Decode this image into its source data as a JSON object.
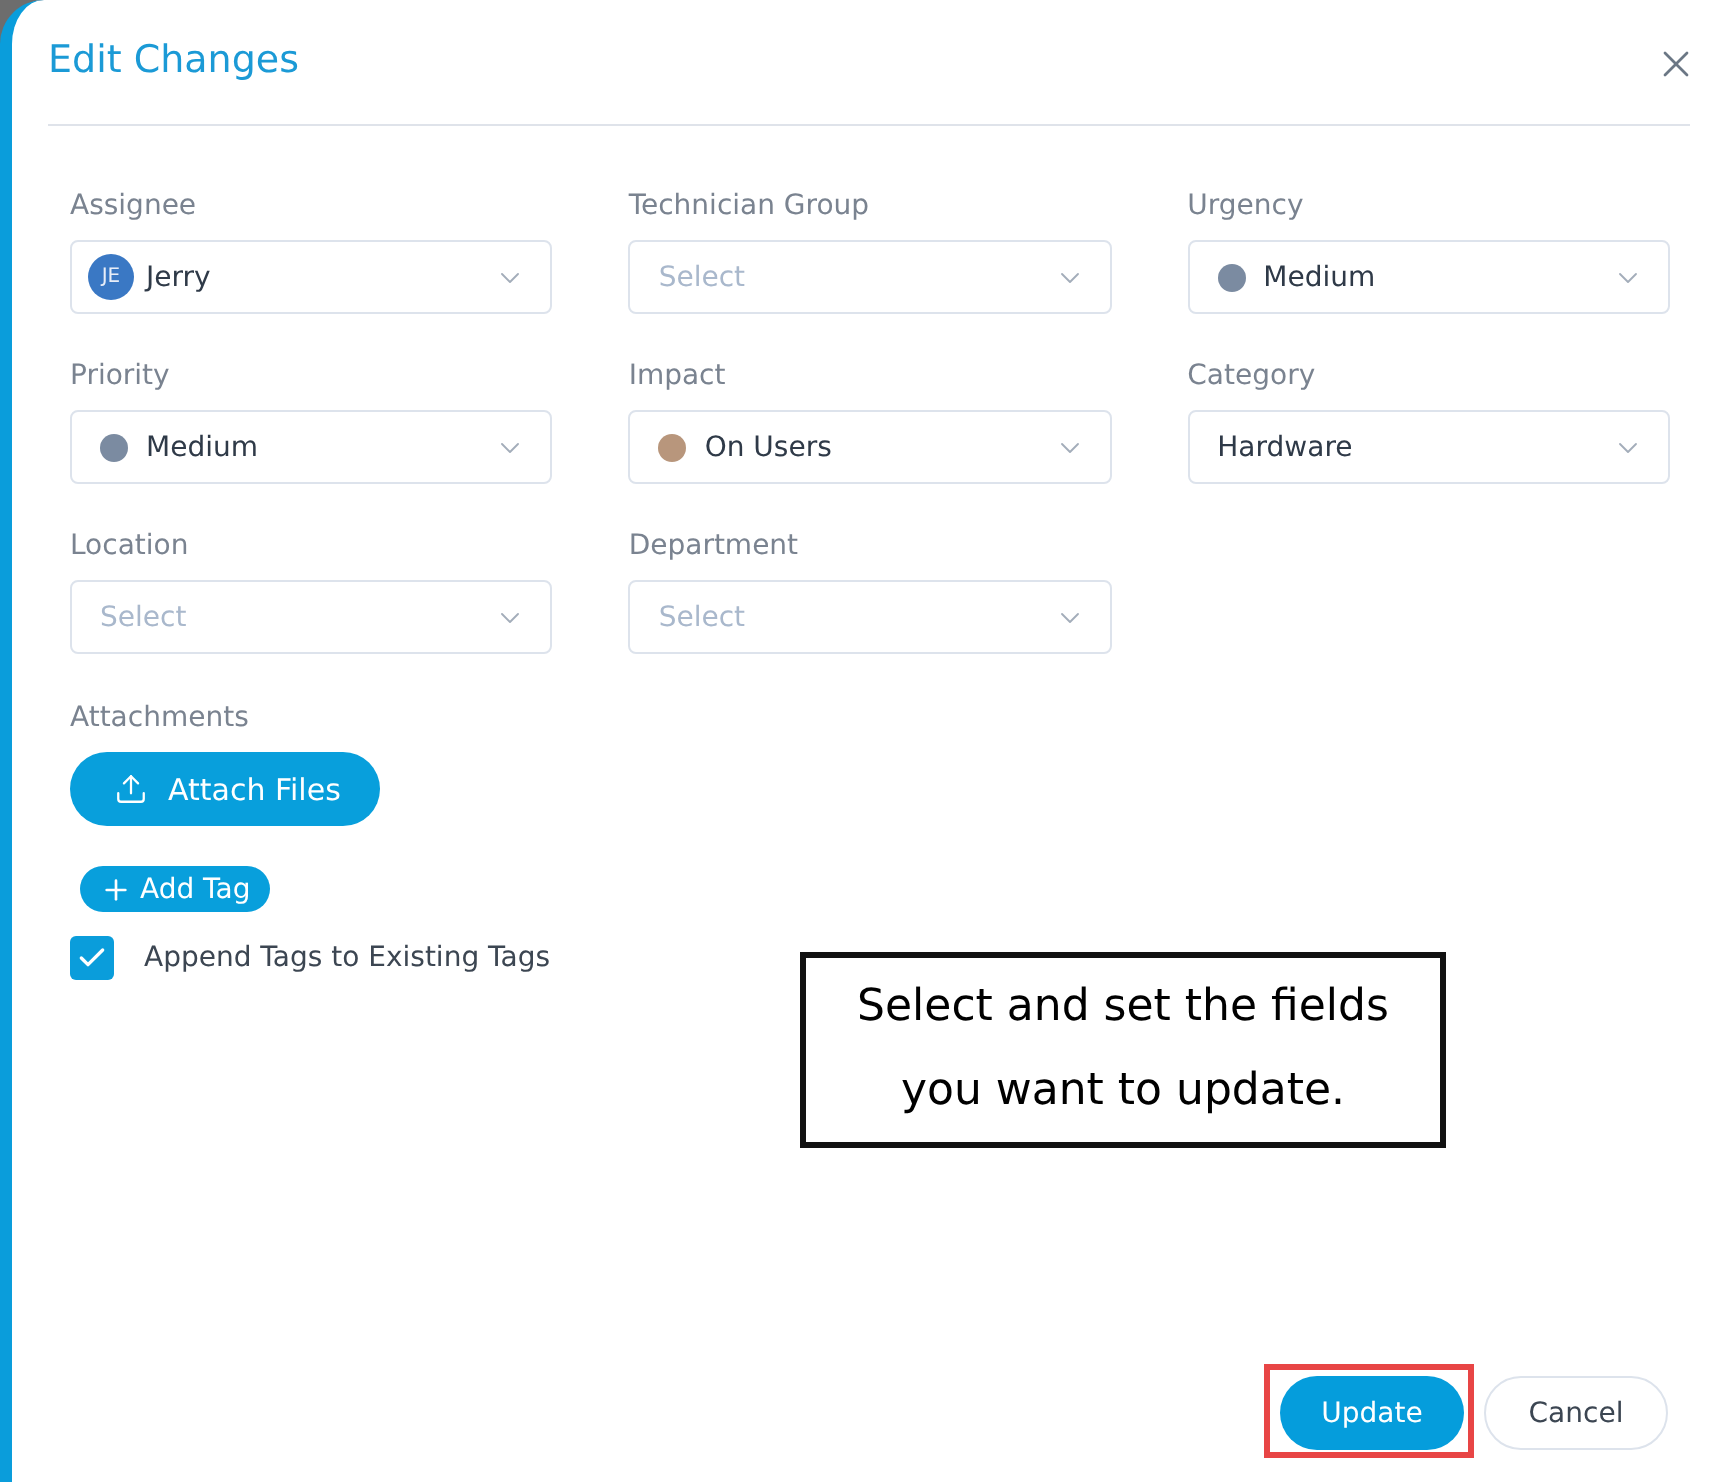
{
  "dialog": {
    "title": "Edit Changes"
  },
  "fields": [
    {
      "label": "Assignee",
      "kind": "avatar",
      "initials": "JE",
      "value": "Jerry"
    },
    {
      "label": "Technician Group",
      "kind": "plain",
      "placeholder": "Select"
    },
    {
      "label": "Urgency",
      "kind": "dot",
      "value": "Medium",
      "color": "#7b8ba1"
    },
    {
      "label": "Priority",
      "kind": "dot",
      "value": "Medium",
      "color": "#7b8ba1"
    },
    {
      "label": "Impact",
      "kind": "dot",
      "value": "On Users",
      "color": "#b8967c"
    },
    {
      "label": "Category",
      "kind": "plain",
      "value": "Hardware"
    },
    {
      "label": "Location",
      "kind": "plain",
      "placeholder": "Select"
    },
    {
      "label": "Department",
      "kind": "plain",
      "placeholder": "Select"
    }
  ],
  "attachments": {
    "label": "Attachments",
    "button": "Attach Files"
  },
  "add_tag": {
    "label": "Add Tag"
  },
  "append_tags": {
    "label": "Append Tags to Existing Tags",
    "checked": true
  },
  "callout": {
    "text": "Select and set the fields you want to update."
  },
  "buttons": [
    {
      "label": "Update",
      "kind": "primary",
      "highlighted": true
    },
    {
      "label": "Cancel",
      "kind": "secondary",
      "highlighted": false
    }
  ]
}
